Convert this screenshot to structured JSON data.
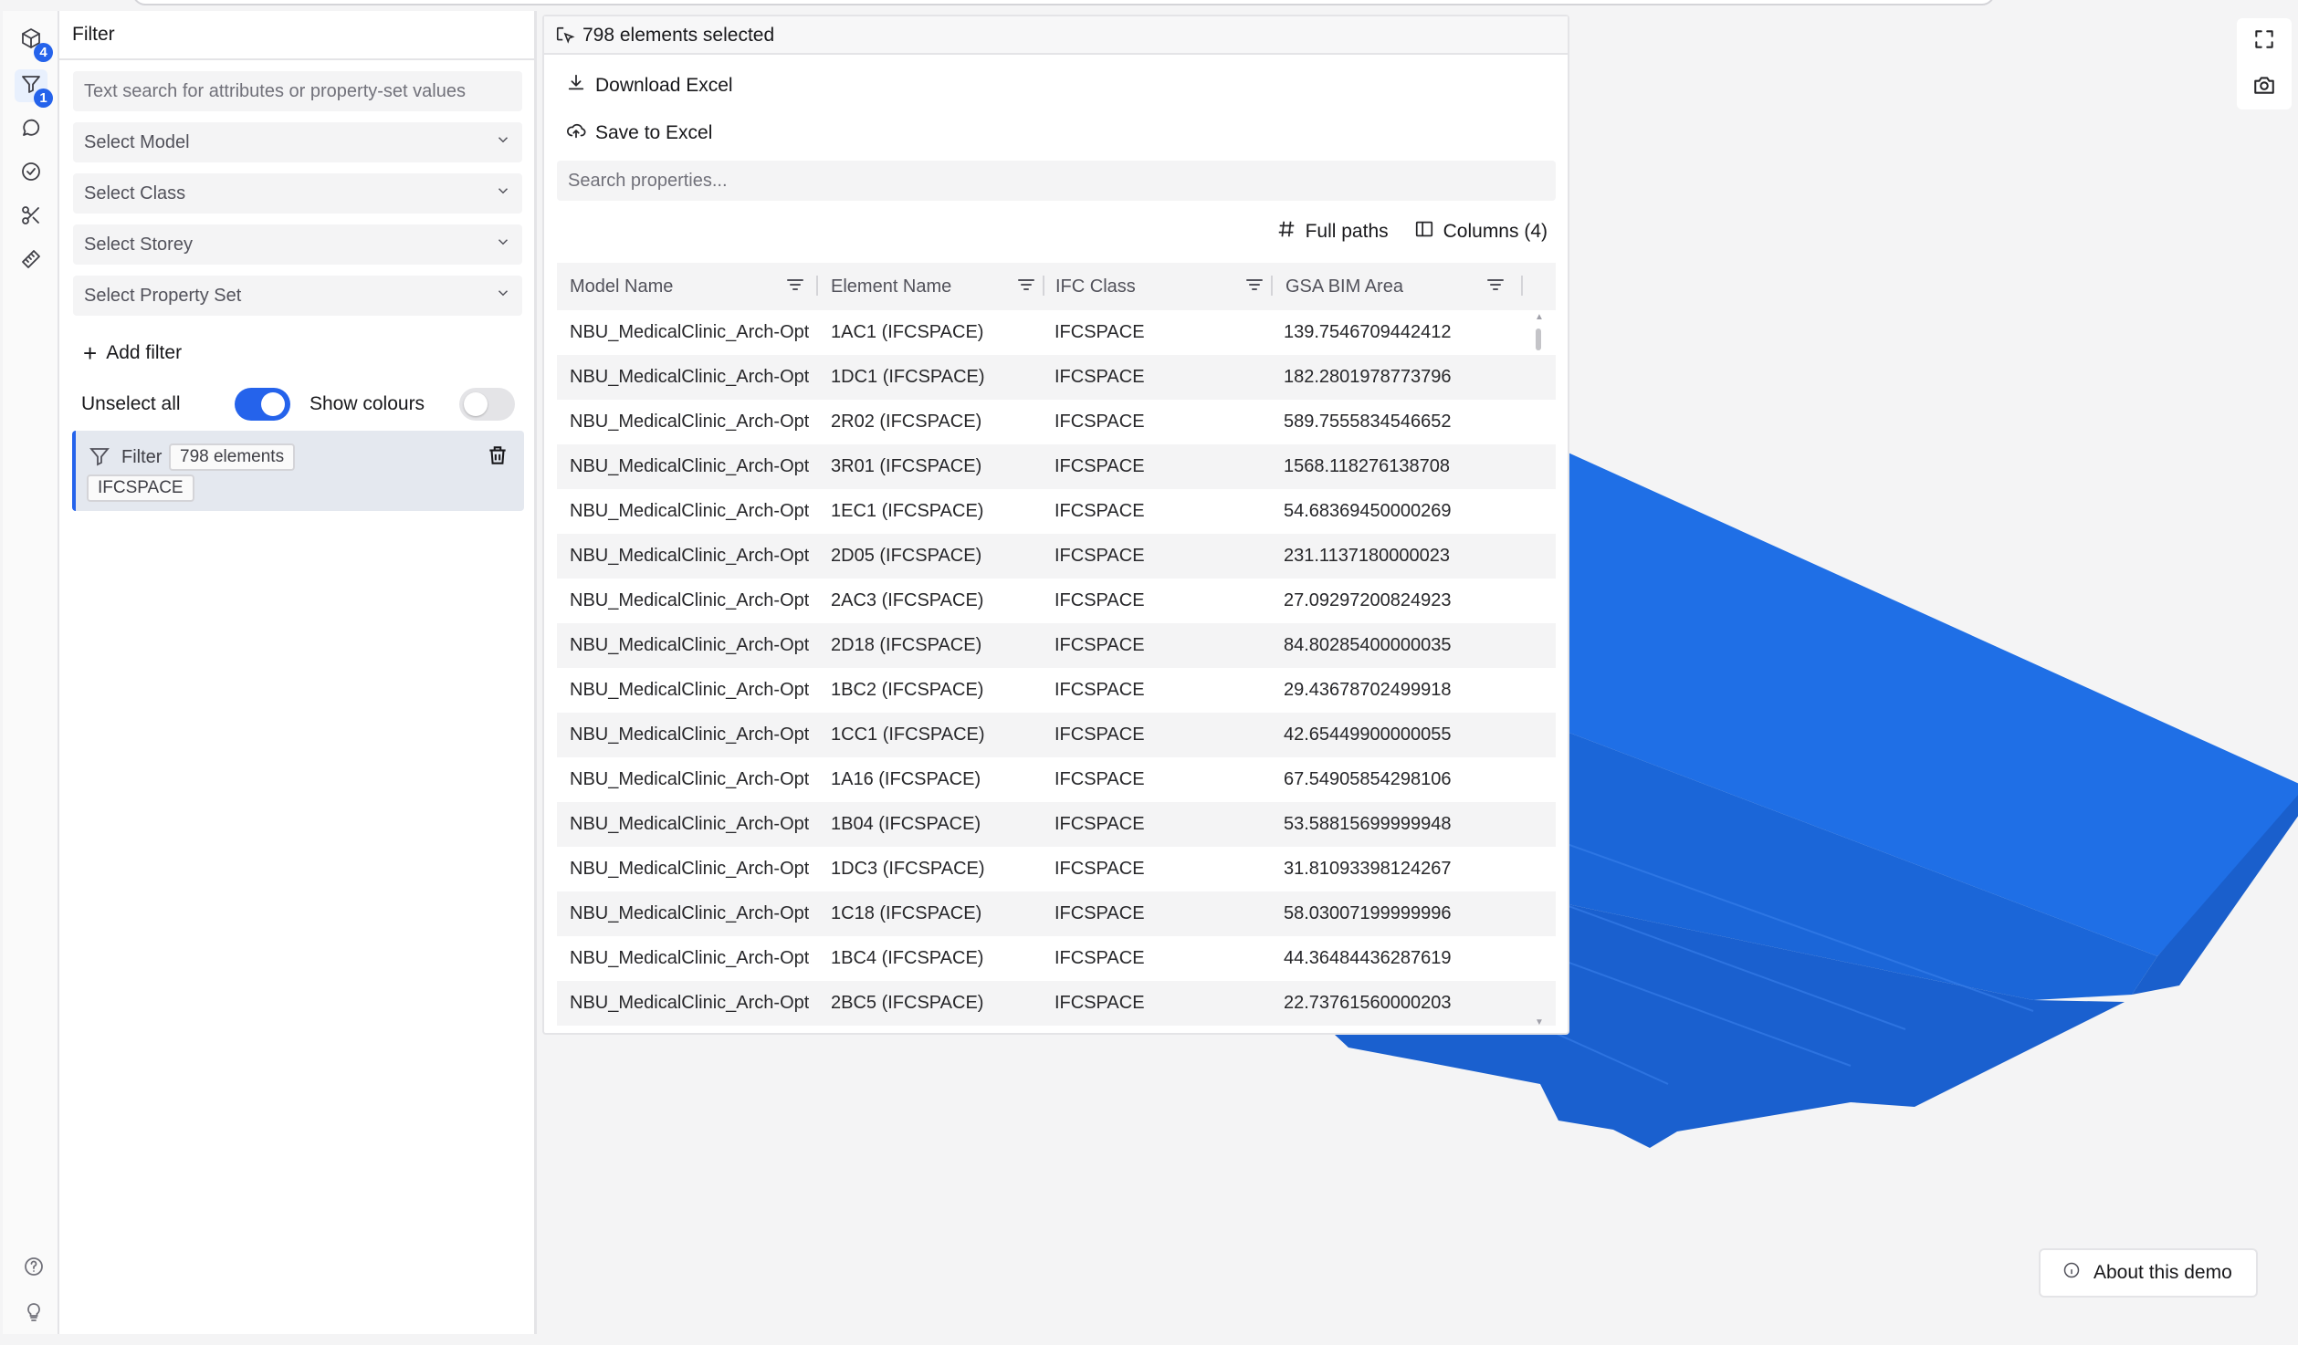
{
  "rail": {
    "models_badge": "4",
    "filter_badge": "1"
  },
  "filter_panel": {
    "title": "Filter",
    "search_placeholder": "Text search for attributes or property-set values",
    "selects": [
      "Select Model",
      "Select Class",
      "Select Storey",
      "Select Property Set"
    ],
    "add_filter": "Add filter",
    "unselect_all": "Unselect all",
    "show_colours": "Show colours",
    "unselect_all_on": true,
    "show_colours_on": false,
    "active_filter": {
      "label": "Filter",
      "count": "798 elements",
      "class_chip": "IFCSPACE"
    }
  },
  "selection_panel": {
    "title": "798 elements selected",
    "download_excel": "Download Excel",
    "save_to_excel": "Save to Excel",
    "search_placeholder": "Search properties...",
    "full_paths": "Full paths",
    "columns": "Columns (4)",
    "table": {
      "headers": [
        "Model Name",
        "Element Name",
        "IFC Class",
        "GSA BIM Area"
      ],
      "rows": [
        [
          "NBU_MedicalClinic_Arch-Optim",
          "1AC1 (IFCSPACE)",
          "IFCSPACE",
          "139.7546709442412"
        ],
        [
          "NBU_MedicalClinic_Arch-Optim",
          "1DC1 (IFCSPACE)",
          "IFCSPACE",
          "182.2801978773796"
        ],
        [
          "NBU_MedicalClinic_Arch-Optim",
          "2R02 (IFCSPACE)",
          "IFCSPACE",
          "589.7555834546652"
        ],
        [
          "NBU_MedicalClinic_Arch-Optim",
          "3R01 (IFCSPACE)",
          "IFCSPACE",
          "1568.118276138708"
        ],
        [
          "NBU_MedicalClinic_Arch-Optim",
          "1EC1 (IFCSPACE)",
          "IFCSPACE",
          "54.68369450000269"
        ],
        [
          "NBU_MedicalClinic_Arch-Optim",
          "2D05 (IFCSPACE)",
          "IFCSPACE",
          "231.1137180000023"
        ],
        [
          "NBU_MedicalClinic_Arch-Optim",
          "2AC3 (IFCSPACE)",
          "IFCSPACE",
          "27.09297200824923"
        ],
        [
          "NBU_MedicalClinic_Arch-Optim",
          "2D18 (IFCSPACE)",
          "IFCSPACE",
          "84.80285400000035"
        ],
        [
          "NBU_MedicalClinic_Arch-Optim",
          "1BC2 (IFCSPACE)",
          "IFCSPACE",
          "29.43678702499918"
        ],
        [
          "NBU_MedicalClinic_Arch-Optim",
          "1CC1 (IFCSPACE)",
          "IFCSPACE",
          "42.65449900000055"
        ],
        [
          "NBU_MedicalClinic_Arch-Optim",
          "1A16 (IFCSPACE)",
          "IFCSPACE",
          "67.54905854298106"
        ],
        [
          "NBU_MedicalClinic_Arch-Optim",
          "1B04 (IFCSPACE)",
          "IFCSPACE",
          "53.58815699999948"
        ],
        [
          "NBU_MedicalClinic_Arch-Optim",
          "1DC3 (IFCSPACE)",
          "IFCSPACE",
          "31.81093398124267"
        ],
        [
          "NBU_MedicalClinic_Arch-Optim",
          "1C18 (IFCSPACE)",
          "IFCSPACE",
          "58.03007199999996"
        ],
        [
          "NBU_MedicalClinic_Arch-Optim",
          "1BC4 (IFCSPACE)",
          "IFCSPACE",
          "44.36484436287619"
        ],
        [
          "NBU_MedicalClinic_Arch-Optim",
          "2BC5 (IFCSPACE)",
          "IFCSPACE",
          "22.73761560000203"
        ]
      ]
    }
  },
  "viewport": {
    "about": "About this demo",
    "model_color": "#1f6fe6"
  },
  "colors": {
    "accent": "#2563eb",
    "panel_bg": "#ffffff",
    "app_bg": "#f4f4f5"
  }
}
